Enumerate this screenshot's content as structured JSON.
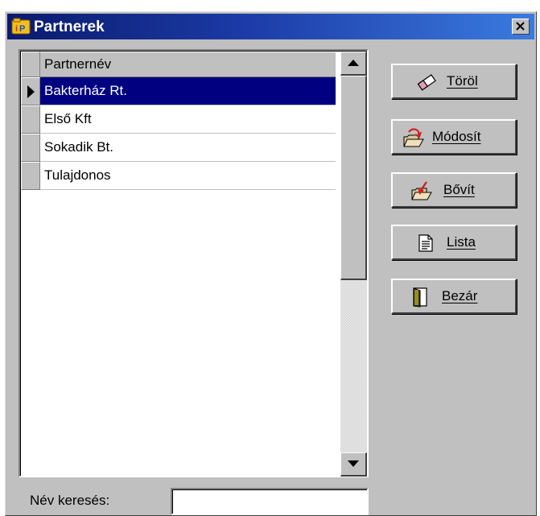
{
  "window": {
    "title": "Partnerek",
    "close_glyph": "×",
    "title_gradient": [
      "#0a1a6e",
      "#3a7be0"
    ]
  },
  "grid": {
    "column_header": "Partnernév",
    "rows": [
      {
        "name": "Bakterház Rt.",
        "selected": true
      },
      {
        "name": "Első Kft",
        "selected": false
      },
      {
        "name": "Sokadik Bt.",
        "selected": false
      },
      {
        "name": "Tulajdonos",
        "selected": false
      }
    ],
    "selection_color": "#000080"
  },
  "search": {
    "label": "Név keresés:",
    "value": ""
  },
  "buttons": {
    "torol": {
      "label": "Töröl",
      "icon": "eraser-icon"
    },
    "modosit": {
      "label": "Módosít",
      "icon": "edit-folder-icon"
    },
    "bovit": {
      "label": "Bővít",
      "icon": "add-folder-icon"
    },
    "lista": {
      "label": "Lista",
      "icon": "document-list-icon"
    },
    "bezar": {
      "label": "Bezár",
      "icon": "door-icon"
    }
  }
}
